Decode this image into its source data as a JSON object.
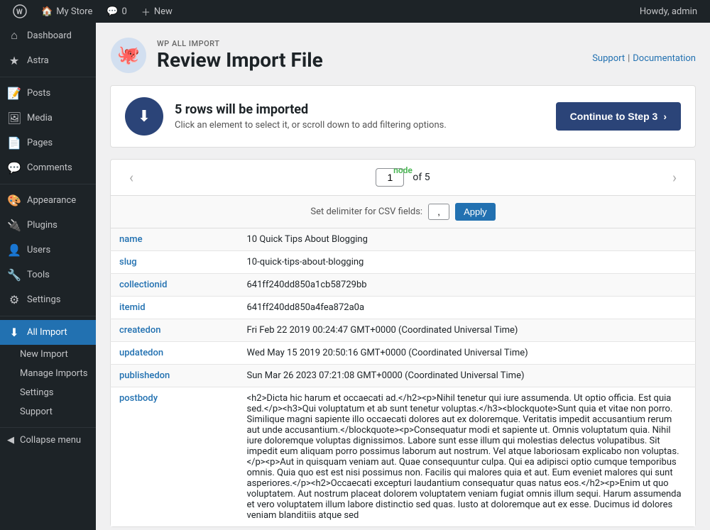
{
  "adminbar": {
    "logo_label": "WordPress",
    "site_name": "My Store",
    "comments_label": "0",
    "new_label": "New",
    "howdy": "Howdy, admin"
  },
  "sidebar": {
    "items": [
      {
        "id": "dashboard",
        "label": "Dashboard",
        "icon": "⌂"
      },
      {
        "id": "astra",
        "label": "Astra",
        "icon": "★"
      },
      {
        "id": "posts",
        "label": "Posts",
        "icon": "📝"
      },
      {
        "id": "media",
        "label": "Media",
        "icon": "🖼"
      },
      {
        "id": "pages",
        "label": "Pages",
        "icon": "📄"
      },
      {
        "id": "comments",
        "label": "Comments",
        "icon": "💬"
      },
      {
        "id": "appearance",
        "label": "Appearance",
        "icon": "🎨"
      },
      {
        "id": "plugins",
        "label": "Plugins",
        "icon": "🔌"
      },
      {
        "id": "users",
        "label": "Users",
        "icon": "👤"
      },
      {
        "id": "tools",
        "label": "Tools",
        "icon": "🔧"
      },
      {
        "id": "settings",
        "label": "Settings",
        "icon": "⚙"
      }
    ],
    "all_import": {
      "label": "All Import",
      "sub_items": [
        {
          "id": "new-import",
          "label": "New Import"
        },
        {
          "id": "manage-imports",
          "label": "Manage Imports"
        },
        {
          "id": "settings",
          "label": "Settings"
        },
        {
          "id": "support",
          "label": "Support"
        }
      ]
    },
    "collapse_label": "Collapse menu"
  },
  "header": {
    "brand": "WP ALL IMPORT",
    "title": "Review Import File",
    "support_label": "Support",
    "documentation_label": "Documentation"
  },
  "banner": {
    "rows_text": "5 rows will be imported",
    "subtitle": "Click an element to select it, or scroll down to add filtering options.",
    "continue_btn": "Continue to Step 3"
  },
  "pager": {
    "node_label": "node",
    "current": "1",
    "total": "5"
  },
  "delimiter": {
    "label": "Set delimiter for CSV fields:",
    "value": ",",
    "apply_label": "Apply"
  },
  "table": {
    "rows": [
      {
        "key": "name",
        "value": "10 Quick Tips About Blogging"
      },
      {
        "key": "slug",
        "value": "10-quick-tips-about-blogging"
      },
      {
        "key": "collectionid",
        "value": "641ff240dd850a1cb58729bb"
      },
      {
        "key": "itemid",
        "value": "641ff240dd850a4fea872a0a"
      },
      {
        "key": "createdon",
        "value": "Fri Feb 22 2019 00:24:47 GMT+0000 (Coordinated Universal Time)"
      },
      {
        "key": "updatedon",
        "value": "Wed May 15 2019 20:50:16 GMT+0000 (Coordinated Universal Time)"
      },
      {
        "key": "publishedon",
        "value": "Sun Mar 26 2023 07:21:08 GMT+0000 (Coordinated Universal Time)"
      },
      {
        "key": "postbody",
        "value": "<h2>Dicta hic harum et occaecati ad.</h2><p>Nihil tenetur qui iure assumenda. Ut optio officia. Est quia sed.</p><h3>Qui voluptatum et ab sunt tenetur voluptas.</h3><blockquote>Sunt quia et vitae non porro. Similique magni sapiente illo occaecati dolores aut ex doloremque. Veritatis impedit accusantium rerum aut unde accusantium.</blockquote><p>Consequatur modi et sapiente ut. Omnis voluptatum quia. Nihil iure doloremque voluptas dignissimos. Labore sunt esse illum qui molestias delectus volupatibus. Sit impedit eum aliquam porro possimus laborum aut nostrum. Vel atque laboriosam explicabo non voluptas.</p><p>Aut in quisquam veniam aut. Quae consequuntur culpa. Qui ea adipisci optio cumque temporibus omnis. Quia quo est est nisi possimus non. Facilis qui malores quia et aut. Eum eveniet malores qui sunt asperiores.</p><h2>Occaecati excepturi laudantium consequatur quas natus eos.</h2><p>Enim ut quo voluptatem. Aut nostrum placeat dolorem voluptatem veniam fugiat omnis illum sequi. Harum assumenda et vero voluptatem illum labore distinctio sed quas. Iusto at doloremque aut ex esse. Ducimus id dolores veniam blanditiis atque sed"
      }
    ]
  }
}
